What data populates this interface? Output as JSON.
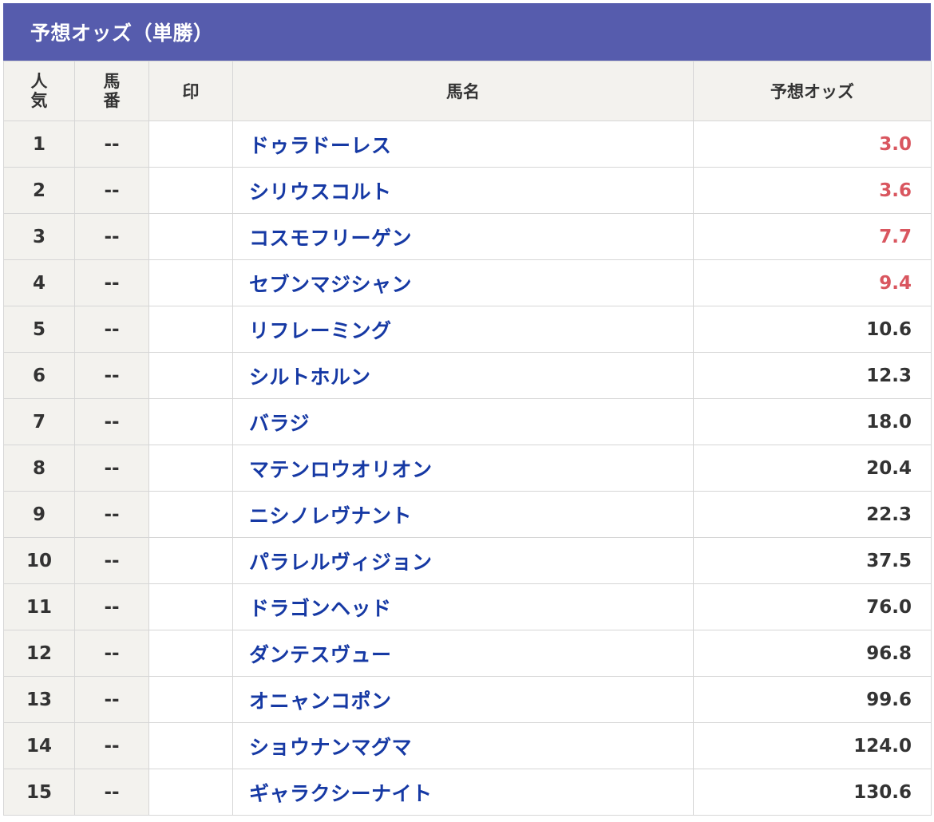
{
  "title": "予想オッズ（単勝）",
  "headers": {
    "rank": [
      "人",
      "気"
    ],
    "number": [
      "馬",
      "番"
    ],
    "mark": "印",
    "name": "馬名",
    "odds": "予想オッズ"
  },
  "colors": {
    "title_bg": "#565cad",
    "header_bg": "#f3f2ee",
    "name_link": "#1639a4",
    "favorite_odds": "#d9565f",
    "normal_odds": "#333333"
  },
  "rows": [
    {
      "rank": "1",
      "number": "--",
      "mark": "",
      "name": "ドゥラドーレス",
      "odds": "3.0",
      "highlight": true
    },
    {
      "rank": "2",
      "number": "--",
      "mark": "",
      "name": "シリウスコルト",
      "odds": "3.6",
      "highlight": true
    },
    {
      "rank": "3",
      "number": "--",
      "mark": "",
      "name": "コスモフリーゲン",
      "odds": "7.7",
      "highlight": true
    },
    {
      "rank": "4",
      "number": "--",
      "mark": "",
      "name": "セブンマジシャン",
      "odds": "9.4",
      "highlight": true
    },
    {
      "rank": "5",
      "number": "--",
      "mark": "",
      "name": "リフレーミング",
      "odds": "10.6",
      "highlight": false
    },
    {
      "rank": "6",
      "number": "--",
      "mark": "",
      "name": "シルトホルン",
      "odds": "12.3",
      "highlight": false
    },
    {
      "rank": "7",
      "number": "--",
      "mark": "",
      "name": "バラジ",
      "odds": "18.0",
      "highlight": false
    },
    {
      "rank": "8",
      "number": "--",
      "mark": "",
      "name": "マテンロウオリオン",
      "odds": "20.4",
      "highlight": false
    },
    {
      "rank": "9",
      "number": "--",
      "mark": "",
      "name": "ニシノレヴナント",
      "odds": "22.3",
      "highlight": false
    },
    {
      "rank": "10",
      "number": "--",
      "mark": "",
      "name": "パラレルヴィジョン",
      "odds": "37.5",
      "highlight": false
    },
    {
      "rank": "11",
      "number": "--",
      "mark": "",
      "name": "ドラゴンヘッド",
      "odds": "76.0",
      "highlight": false
    },
    {
      "rank": "12",
      "number": "--",
      "mark": "",
      "name": "ダンテスヴュー",
      "odds": "96.8",
      "highlight": false
    },
    {
      "rank": "13",
      "number": "--",
      "mark": "",
      "name": "オニャンコポン",
      "odds": "99.6",
      "highlight": false
    },
    {
      "rank": "14",
      "number": "--",
      "mark": "",
      "name": "ショウナンマグマ",
      "odds": "124.0",
      "highlight": false
    },
    {
      "rank": "15",
      "number": "--",
      "mark": "",
      "name": "ギャラクシーナイト",
      "odds": "130.6",
      "highlight": false
    }
  ]
}
